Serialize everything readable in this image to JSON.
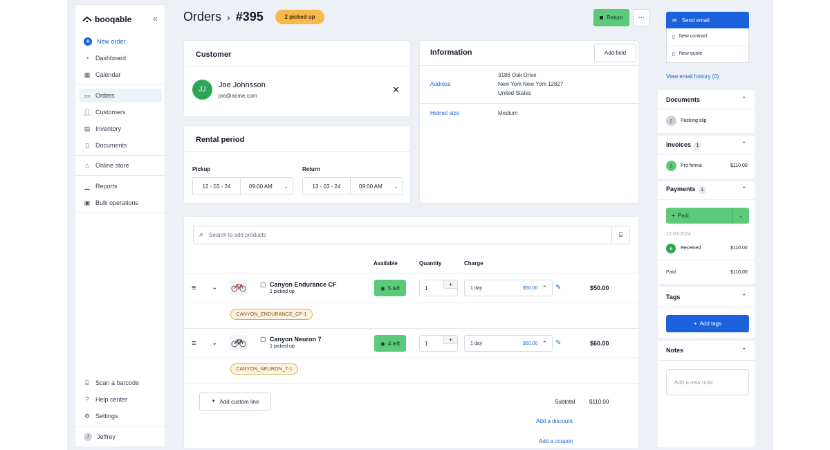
{
  "app": {
    "logo_text": "booqable"
  },
  "sidebar": {
    "new_order": "New order",
    "items": [
      {
        "label": "Dashboard",
        "icon": "dashboard-icon"
      },
      {
        "label": "Calendar",
        "icon": "calendar-icon"
      },
      {
        "label": "Orders",
        "icon": "orders-icon"
      },
      {
        "label": "Customers",
        "icon": "customers-icon"
      },
      {
        "label": "Inventory",
        "icon": "inventory-icon"
      },
      {
        "label": "Documents",
        "icon": "documents-icon"
      },
      {
        "label": "Online store",
        "icon": "store-icon"
      },
      {
        "label": "Reports",
        "icon": "reports-icon"
      },
      {
        "label": "Bulk operations",
        "icon": "bulk-icon"
      },
      {
        "label": "Scan a barcode",
        "icon": "barcode-icon"
      },
      {
        "label": "Help center",
        "icon": "help-icon"
      },
      {
        "label": "Settings",
        "icon": "gear-icon"
      }
    ],
    "user": {
      "name": "Jeffrey",
      "initial": "J"
    }
  },
  "header": {
    "breadcrumb": "Orders",
    "order_number": "#395",
    "status": "2 picked up",
    "return_label": "Return",
    "more_label": "···"
  },
  "customer": {
    "title": "Customer",
    "initials": "JJ",
    "name": "Joe Johnsson",
    "email": "joe@acme.com"
  },
  "rental": {
    "title": "Rental period",
    "pickup_label": "Pickup",
    "pickup_date": "12 - 03 - 24",
    "pickup_time": "09:00 AM",
    "return_label": "Return",
    "return_date": "13 - 03 - 24",
    "return_time": "09:00 AM"
  },
  "information": {
    "title": "Information",
    "add_field": "Add field",
    "address_label": "Address",
    "address_line1": "3186 Oak Drive",
    "address_line2": "New York New York 12827",
    "address_line3": "United States",
    "helmet_label": "Helmet size",
    "helmet_value": "Medium"
  },
  "products": {
    "search_placeholder": "Search to add products",
    "columns": {
      "available": "Available",
      "quantity": "Quantity",
      "charge": "Charge"
    },
    "rows": [
      {
        "name": "Canyon Endurance CF",
        "status": "1 picked up",
        "available": "5 left",
        "quantity": "1",
        "charge_period": "1 day",
        "charge_price": "$50.00",
        "total": "$50.00",
        "tag": "CANYON_ENDURANCE_CF-1"
      },
      {
        "name": "Canyon Neuron 7",
        "status": "1 picked up",
        "available": "4 left",
        "quantity": "1",
        "charge_period": "1 day",
        "charge_price": "$60.00",
        "total": "$60.00",
        "tag": "CANYON_NEURON_7-1"
      }
    ],
    "add_custom_line": "Add custom line",
    "subtotal_label": "Subtotal",
    "subtotal_value": "$110.00",
    "add_discount": "Add a discount",
    "add_coupon": "Add a coupon"
  },
  "right_panel": {
    "send_email": "Send email",
    "new_contract": "New contract",
    "new_quote": "New quote",
    "email_history": "View email history (0)",
    "documents": {
      "title": "Documents",
      "packing_slip": "Packing slip"
    },
    "invoices": {
      "title": "Invoices",
      "count": "1",
      "name": "Pro forma",
      "amount": "$110.00"
    },
    "payments": {
      "title": "Payments",
      "count": "1",
      "paid_button": "Paid",
      "date": "12-03-2024",
      "received_label": "Received",
      "received_amount": "$110.00",
      "paid_label": "Paid",
      "paid_amount": "$110.00"
    },
    "tags": {
      "title": "Tags",
      "add_tags": "Add tags"
    },
    "notes": {
      "title": "Notes",
      "placeholder": "Add a new note"
    }
  },
  "colors": {
    "accent": "#1a61db",
    "success": "#5cca7a",
    "warning": "#f6b94a",
    "tag_border": "#e0a94c"
  }
}
